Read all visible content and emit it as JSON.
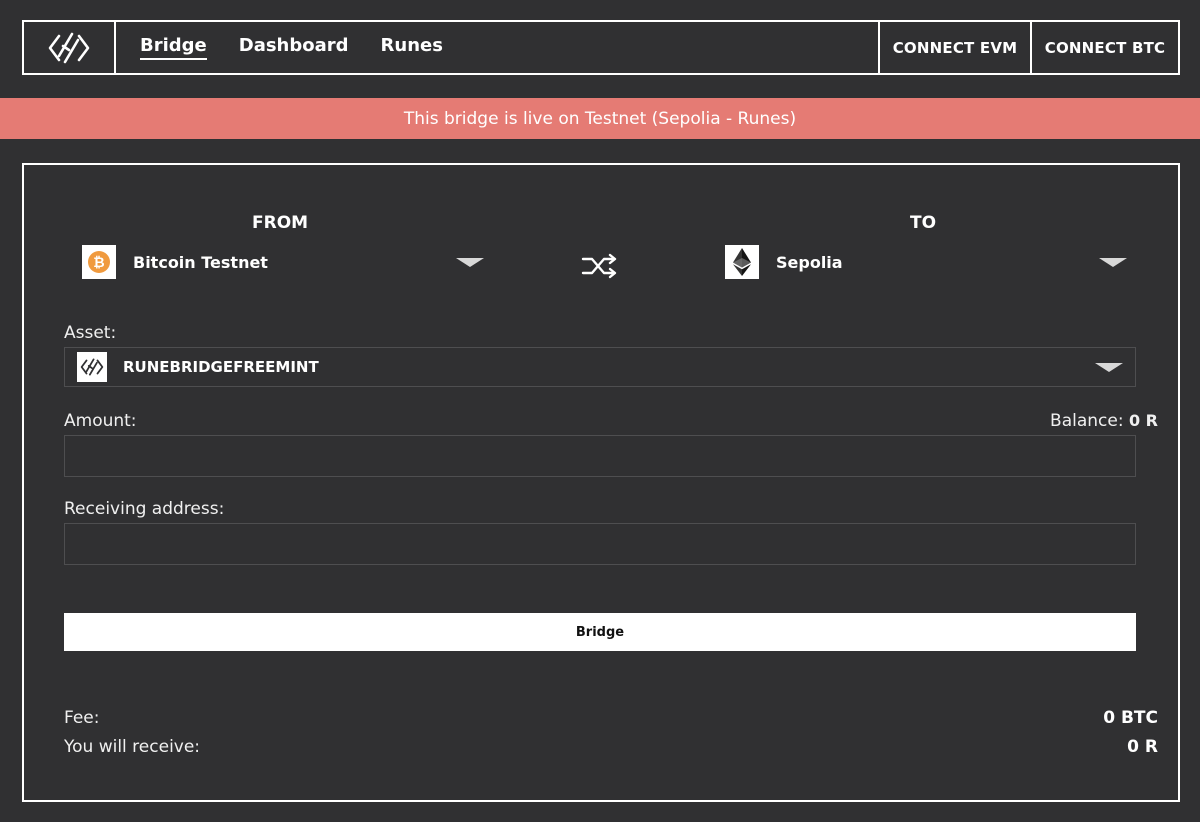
{
  "header": {
    "logo_icon": "runebridge-logo-icon",
    "nav": [
      {
        "label": "Bridge",
        "active": true
      },
      {
        "label": "Dashboard",
        "active": false
      },
      {
        "label": "Runes",
        "active": false
      }
    ],
    "connect_evm_label": "CONNECT EVM",
    "connect_btc_label": "CONNECT BTC"
  },
  "banner": {
    "text": "This bridge is live on Testnet (Sepolia - Runes)",
    "color": "#e57b74"
  },
  "bridge_form": {
    "from": {
      "title": "FROM",
      "chain_name": "Bitcoin Testnet",
      "chain_icon": "bitcoin-icon",
      "icon_color": "#f09a3e"
    },
    "swap_icon": "shuffle-icon",
    "to": {
      "title": "TO",
      "chain_name": "Sepolia",
      "chain_icon": "ethereum-icon"
    },
    "asset": {
      "label": "Asset:",
      "selected": "RUNEBRIDGEFREEMINT",
      "icon": "runebridge-logo-icon"
    },
    "amount": {
      "label": "Amount:",
      "value": "",
      "placeholder": "",
      "balance_label": "Balance: ",
      "balance_value": "0 R"
    },
    "receiving_address": {
      "label": "Receiving address:",
      "value": "",
      "placeholder": ""
    },
    "submit_label": "Bridge",
    "summary": {
      "fee_label": "Fee:",
      "fee_value": "0 BTC",
      "receive_label": "You will receive:",
      "receive_value": "0 R"
    }
  }
}
